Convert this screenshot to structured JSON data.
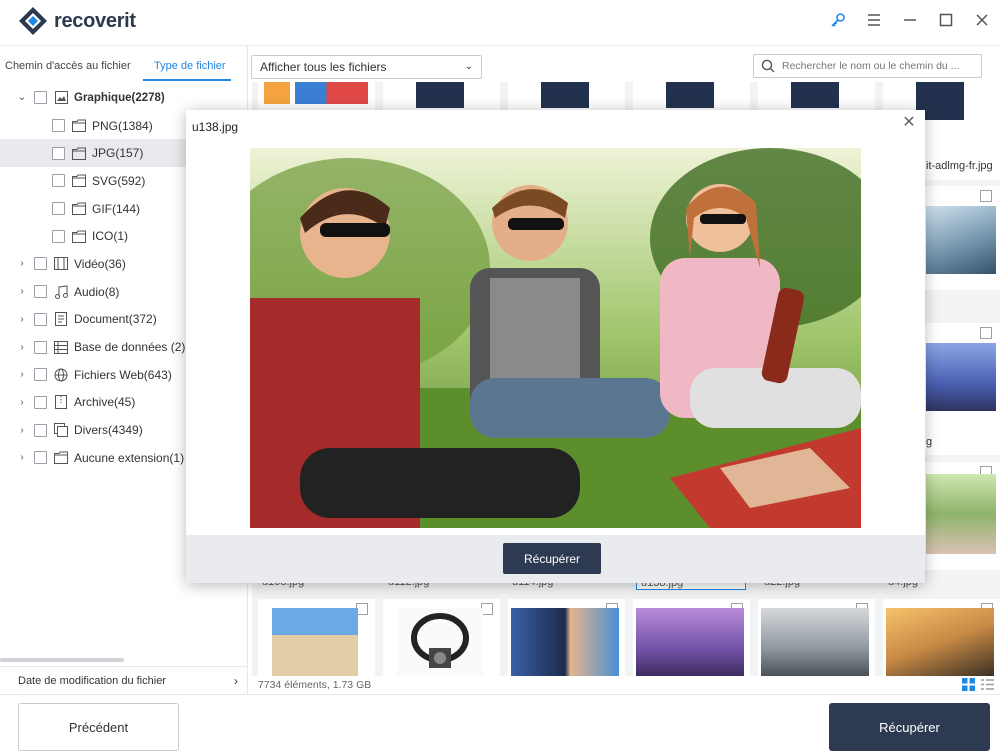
{
  "app": {
    "name": "recoverit"
  },
  "colors": {
    "accent": "#1e88e5",
    "primary_button": "#2d3a52"
  },
  "window_controls": {
    "key_icon": "key-icon",
    "menu_icon": "hamburger-menu-icon",
    "minimize_icon": "minimize-icon",
    "maximize_icon": "maximize-icon",
    "close_icon": "close-icon"
  },
  "sidebar": {
    "tabs": [
      {
        "label": "Chemin d'accès au fichier",
        "active": false
      },
      {
        "label": "Type de fichier",
        "active": true
      }
    ],
    "tree": [
      {
        "label": "Graphique(2278)",
        "level": 0,
        "expanded": true,
        "icon": "image-icon"
      },
      {
        "label": "PNG(1384)",
        "level": 1,
        "icon": "folder-icon"
      },
      {
        "label": "JPG(157)",
        "level": 1,
        "icon": "folder-icon",
        "selected": true
      },
      {
        "label": "SVG(592)",
        "level": 1,
        "icon": "folder-icon"
      },
      {
        "label": "GIF(144)",
        "level": 1,
        "icon": "folder-icon"
      },
      {
        "label": "ICO(1)",
        "level": 1,
        "icon": "folder-icon"
      },
      {
        "label": "Vidéo(36)",
        "level": 0,
        "icon": "video-icon"
      },
      {
        "label": "Audio(8)",
        "level": 0,
        "icon": "music-icon"
      },
      {
        "label": "Document(372)",
        "level": 0,
        "icon": "document-icon"
      },
      {
        "label": "Base de données (2)",
        "level": 0,
        "icon": "database-icon"
      },
      {
        "label": "Fichiers Web(643)",
        "level": 0,
        "icon": "globe-icon"
      },
      {
        "label": "Archive(45)",
        "level": 0,
        "icon": "archive-icon"
      },
      {
        "label": "Divers(4349)",
        "level": 0,
        "icon": "misc-icon"
      },
      {
        "label": "Aucune extension(1)",
        "level": 0,
        "icon": "folder-icon"
      }
    ],
    "date_filter": "Date de modification du fichier"
  },
  "toolbar": {
    "filter_value": "Afficher tous les fichiers",
    "search_placeholder": "Rechercher le nom ou le chemin du ..."
  },
  "grid": {
    "partial_names_row2": [
      "u108.jpg",
      "u112.jpg",
      "u114.jpg",
      "u138.jpg",
      "u22.jpg",
      "u4.jpg"
    ],
    "visible_name_row1": "it-adlmg-fr.jpg",
    "side_name_g": "g"
  },
  "status": {
    "count": "7734 éléments, 1.73 GB"
  },
  "preview": {
    "filename": "u138.jpg",
    "recover_label": "Récupérer"
  },
  "footer": {
    "prev_label": "Précédent",
    "recover_label": "Récupérer"
  }
}
